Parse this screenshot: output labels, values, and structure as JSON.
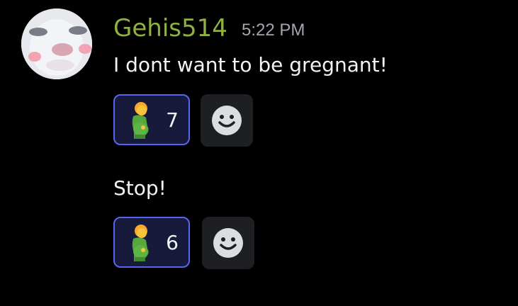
{
  "author": {
    "username": "Gehis514",
    "timestamp": "5:22 PM"
  },
  "messages": [
    {
      "text": "I dont want to be gregnant!",
      "reaction": {
        "emoji": "pregnant-man-emoji",
        "count": "7"
      }
    },
    {
      "text": "Stop!",
      "reaction": {
        "emoji": "pregnant-man-emoji",
        "count": "6"
      }
    }
  ],
  "colors": {
    "background": "#000000",
    "username": "#8fb141",
    "timestamp": "#a3a6ad",
    "text": "#f2f3f5",
    "reaction_border": "#5865f2",
    "reaction_bg": "#171a3b",
    "add_reaction_bg": "#1e1f22"
  },
  "icons": {
    "add_reaction": "smiley-icon"
  }
}
